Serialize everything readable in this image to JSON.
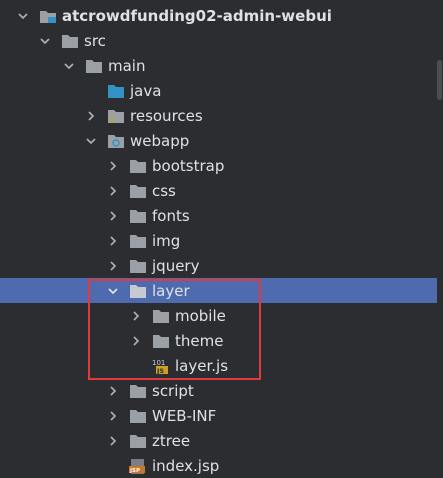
{
  "project_tree": {
    "root": {
      "label": "atcrowdfunding02-admin-webui",
      "expanded": true
    },
    "src": {
      "label": "src",
      "expanded": true
    },
    "main": {
      "label": "main",
      "expanded": true
    },
    "java": {
      "label": "java"
    },
    "resources": {
      "label": "resources",
      "expanded": false
    },
    "webapp": {
      "label": "webapp",
      "expanded": true
    },
    "bootstrap": {
      "label": "bootstrap",
      "expanded": false
    },
    "css": {
      "label": "css",
      "expanded": false
    },
    "fonts": {
      "label": "fonts",
      "expanded": false
    },
    "img": {
      "label": "img",
      "expanded": false
    },
    "jquery": {
      "label": "jquery",
      "expanded": false
    },
    "layer": {
      "label": "layer",
      "expanded": true,
      "selected": true
    },
    "mobile": {
      "label": "mobile",
      "expanded": false
    },
    "theme": {
      "label": "theme",
      "expanded": false
    },
    "layer_js": {
      "label": "layer.js",
      "icon_text": "101\nJS"
    },
    "script": {
      "label": "script",
      "expanded": false
    },
    "web_inf": {
      "label": "WEB-INF",
      "expanded": false
    },
    "ztree": {
      "label": "ztree",
      "expanded": false
    },
    "index_jsp": {
      "label": "index.jsp",
      "icon_text": "JSP"
    }
  },
  "icons": {
    "folder": "folder-icon",
    "module": "module-folder-icon",
    "source_root": "source-folder-icon",
    "resources_root": "resources-folder-icon",
    "web_root": "web-folder-icon",
    "js_file": "javascript-file-icon",
    "jsp_file": "jsp-file-icon",
    "chevron_right": "chevron-right-icon",
    "chevron_down": "chevron-down-icon"
  },
  "colors": {
    "background": "#2b2d30",
    "selection": "#4e6bb0",
    "highlight_border": "#e03a3e",
    "folder": "#9aa0a6",
    "source_folder": "#3592c4"
  }
}
